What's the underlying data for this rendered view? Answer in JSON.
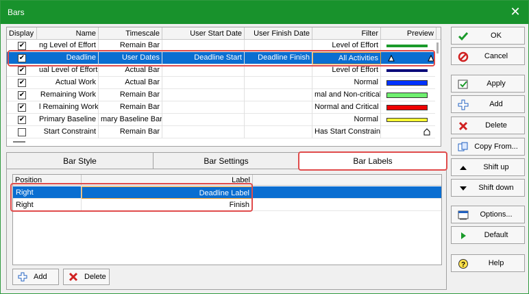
{
  "window": {
    "title": "Bars",
    "close_symbol": "✕"
  },
  "grid": {
    "columns": [
      "Display",
      "Name",
      "Timescale",
      "User Start Date",
      "User Finish Date",
      "Filter",
      "Preview"
    ],
    "rows": [
      {
        "checked": true,
        "name": "ng Level of Effort",
        "timescale": "Remain Bar",
        "start": "",
        "finish": "",
        "filter": "Level of Effort",
        "preview": "green-thin",
        "selected": false
      },
      {
        "checked": true,
        "name": "Deadline",
        "timescale": "User Dates",
        "start": "Deadline Start",
        "finish": "Deadline Finish",
        "filter": "All Activities",
        "preview": "deadline-markers",
        "selected": true
      },
      {
        "checked": true,
        "name": "ual Level of Effort",
        "timescale": "Actual Bar",
        "start": "",
        "finish": "",
        "filter": "Level of Effort",
        "preview": "navy-thin",
        "selected": false
      },
      {
        "checked": true,
        "name": "Actual Work",
        "timescale": "Actual Bar",
        "start": "",
        "finish": "",
        "filter": "Normal",
        "preview": "blue-bar",
        "selected": false
      },
      {
        "checked": true,
        "name": "Remaining Work",
        "timescale": "Remain Bar",
        "start": "",
        "finish": "",
        "filter": "mal and Non-critical",
        "preview": "lightgreen-bar",
        "selected": false
      },
      {
        "checked": true,
        "name": "l Remaining Work",
        "timescale": "Remain Bar",
        "start": "",
        "finish": "",
        "filter": "Normal and Critical",
        "preview": "red-bar",
        "selected": false
      },
      {
        "checked": true,
        "name": "Primary Baseline",
        "timescale": "mary Baseline Bar",
        "start": "",
        "finish": "",
        "filter": "Normal",
        "preview": "yellow-bar",
        "selected": false
      },
      {
        "checked": false,
        "name": "Start Constraint",
        "timescale": "Remain Bar",
        "start": "",
        "finish": "",
        "filter": "Has Start Constraint",
        "preview": "house-marker",
        "selected": false
      }
    ]
  },
  "tabs": [
    {
      "label": "Bar Style",
      "active": false
    },
    {
      "label": "Bar Settings",
      "active": false
    },
    {
      "label": "Bar Labels",
      "active": true
    }
  ],
  "labels_grid": {
    "columns": [
      "Position",
      "Label"
    ],
    "rows": [
      {
        "position": "Right",
        "label": "Deadline Label",
        "selected": true
      },
      {
        "position": "Right",
        "label": "Finish",
        "selected": false
      }
    ]
  },
  "bottom_buttons": {
    "add": "Add",
    "delete": "Delete"
  },
  "side_buttons": {
    "ok": "OK",
    "cancel": "Cancel",
    "apply": "Apply",
    "add": "Add",
    "delete": "Delete",
    "copy_from": "Copy From...",
    "shift_up": "Shift up",
    "shift_down": "Shift down",
    "options": "Options...",
    "default": "Default",
    "help": "Help"
  },
  "colors": {
    "title_bar": "#18922c",
    "selection": "#0a6ed1",
    "highlight": "#e04b4b",
    "bar_green": "#1a9a2a",
    "bar_navy": "#0b0b7a",
    "bar_blue": "#0033ff",
    "bar_lightgreen": "#6ff06f",
    "bar_red": "#ee0000",
    "bar_yellow": "#ffff33"
  }
}
